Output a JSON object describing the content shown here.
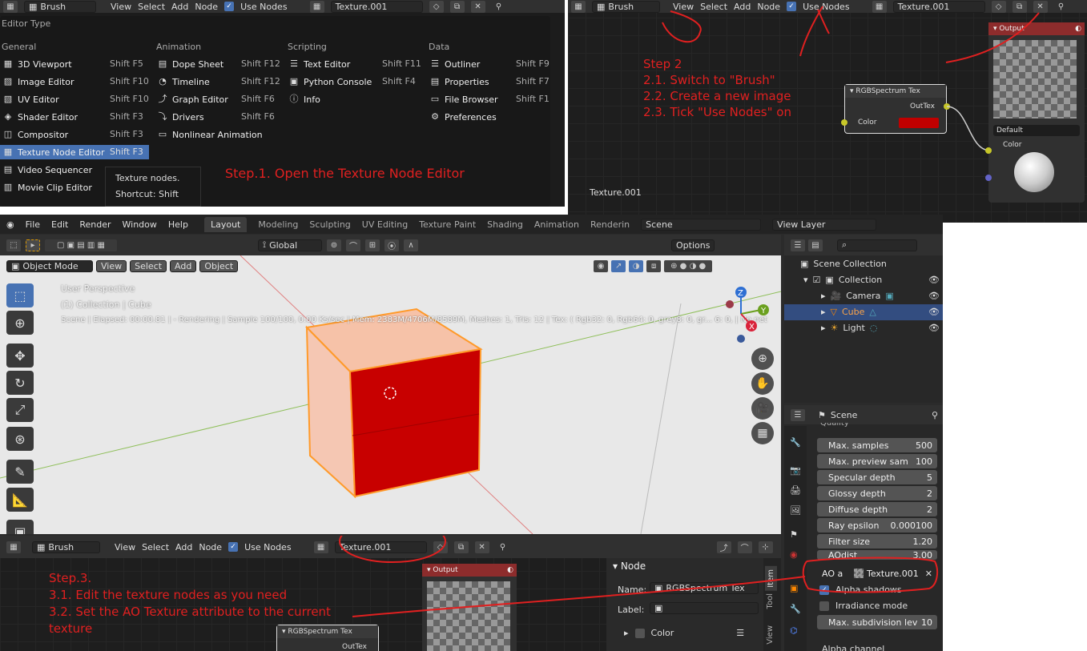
{
  "panel1": {
    "header": {
      "editor": "Brush",
      "menus": [
        "View",
        "Select",
        "Add",
        "Node"
      ],
      "use_nodes": "Use Nodes",
      "texture": "Texture.001"
    },
    "menu_title": "Editor Type",
    "cols": [
      {
        "title": "General",
        "items": [
          {
            "label": "3D Viewport",
            "sc": "Shift F5"
          },
          {
            "label": "Image Editor",
            "sc": "Shift F10"
          },
          {
            "label": "UV Editor",
            "sc": "Shift F10"
          },
          {
            "label": "Shader Editor",
            "sc": "Shift F3"
          },
          {
            "label": "Compositor",
            "sc": "Shift F3"
          },
          {
            "label": "Texture Node Editor",
            "sc": "Shift F3"
          },
          {
            "label": "Video Sequencer",
            "sc": ""
          },
          {
            "label": "Movie Clip Editor",
            "sc": ""
          }
        ]
      },
      {
        "title": "Animation",
        "items": [
          {
            "label": "Dope Sheet",
            "sc": "Shift F12"
          },
          {
            "label": "Timeline",
            "sc": "Shift F12"
          },
          {
            "label": "Graph Editor",
            "sc": "Shift F6"
          },
          {
            "label": "Drivers",
            "sc": "Shift F6"
          },
          {
            "label": "Nonlinear Animation",
            "sc": ""
          }
        ]
      },
      {
        "title": "Scripting",
        "items": [
          {
            "label": "Text Editor",
            "sc": "Shift F11"
          },
          {
            "label": "Python Console",
            "sc": "Shift F4"
          },
          {
            "label": "Info",
            "sc": ""
          }
        ]
      },
      {
        "title": "Data",
        "items": [
          {
            "label": "Outliner",
            "sc": "Shift F9"
          },
          {
            "label": "Properties",
            "sc": "Shift F7"
          },
          {
            "label": "File Browser",
            "sc": "Shift F1"
          },
          {
            "label": "Preferences",
            "sc": ""
          }
        ]
      }
    ],
    "tooltip": {
      "line1": "Texture nodes.",
      "line2": "Shortcut: Shift F3"
    },
    "annotation": "Step.1. Open the Texture Node Editor"
  },
  "panel2": {
    "header": {
      "editor": "Brush",
      "menus": [
        "View",
        "Select",
        "Add",
        "Node"
      ],
      "use_nodes": "Use Nodes",
      "texture": "Texture.001"
    },
    "annotation": [
      "Step 2",
      "2.1. Switch to \"Brush\"",
      "2.2. Create a new image",
      "2.3. Tick \"Use Nodes\" on"
    ],
    "node_rgb": {
      "title": "RGBSpectrum Tex",
      "out": "OutTex",
      "in": "Color",
      "color": "#c00000"
    },
    "node_output": {
      "title": "Output",
      "name": "Default",
      "socket": "Color"
    },
    "bottom_label": "Texture.001"
  },
  "main": {
    "menubar": [
      "File",
      "Edit",
      "Render",
      "Window",
      "Help"
    ],
    "workspaces": [
      "Layout",
      "Modeling",
      "Sculpting",
      "UV Editing",
      "Texture Paint",
      "Shading",
      "Animation",
      "Renderin"
    ],
    "scene": "Scene",
    "view_layer": "View Layer",
    "toolbar": {
      "orientation": "Global",
      "options": "Options"
    },
    "header2": {
      "mode": "Object Mode",
      "menus": [
        "View",
        "Select",
        "Add",
        "Object"
      ]
    },
    "overlay": {
      "persp": "User Perspective",
      "collection": "(1) Collection | Cube",
      "status": "Scene | Elapsed: 00:00.81 |  - Rendering | Sample 100/100, 0.00 Ks/sec | Mem: 2383M/4706M/8589M, Meshes: 1, Tris: 12 | Tex: ( Rgb32: 0, Rgb64: 0, grey8: 0, gr... 6: 0, | No net"
    },
    "outliner": {
      "title": "Scene Collection",
      "items": [
        {
          "label": "Collection"
        },
        {
          "label": "Camera"
        },
        {
          "label": "Cube"
        },
        {
          "label": "Light"
        }
      ]
    },
    "props": {
      "title": "Scene",
      "section": "Quality",
      "rows": [
        {
          "label": "Max. samples",
          "value": "500"
        },
        {
          "label": "Max. preview sam",
          "value": "100"
        },
        {
          "label": "Specular depth",
          "value": "5"
        },
        {
          "label": "Glossy depth",
          "value": "2"
        },
        {
          "label": "Diffuse depth",
          "value": "2"
        },
        {
          "label": "Ray epsilon",
          "value": "0.000100"
        },
        {
          "label": "Filter size",
          "value": "1.20"
        },
        {
          "label": "AOdist",
          "value": "3.00"
        }
      ],
      "ao_label": "AO a",
      "ao_texture": "Texture.001",
      "alpha_shadows": "Alpha shadows",
      "irradiance": "Irradiance mode",
      "subdiv": {
        "label": "Max. subdivision lev",
        "value": "10"
      },
      "alpha_channel": "Alpha channel"
    }
  },
  "panel3": {
    "header": {
      "editor": "Brush",
      "menus": [
        "View",
        "Select",
        "Add",
        "Node"
      ],
      "use_nodes": "Use Nodes",
      "texture": "Texture.001"
    },
    "annotation": [
      "Step.3.",
      "3.1. Edit the texture nodes as you need",
      "3.2. Set the AO Texture attribute to the current",
      "texture"
    ],
    "node_output": "Output",
    "node_rgb": {
      "title": "RGBSpectrum Tex",
      "out": "OutTex"
    },
    "sidebar": {
      "section": "Node",
      "name_label": "Name:",
      "name_value": "RGBSpectrum Tex",
      "label_label": "Label:",
      "color": "Color",
      "tabs": [
        "Item",
        "Tool",
        "View"
      ]
    }
  },
  "colors": {
    "annotation": "#e02020",
    "selected": "#4772b3",
    "cube": "#c80000"
  }
}
